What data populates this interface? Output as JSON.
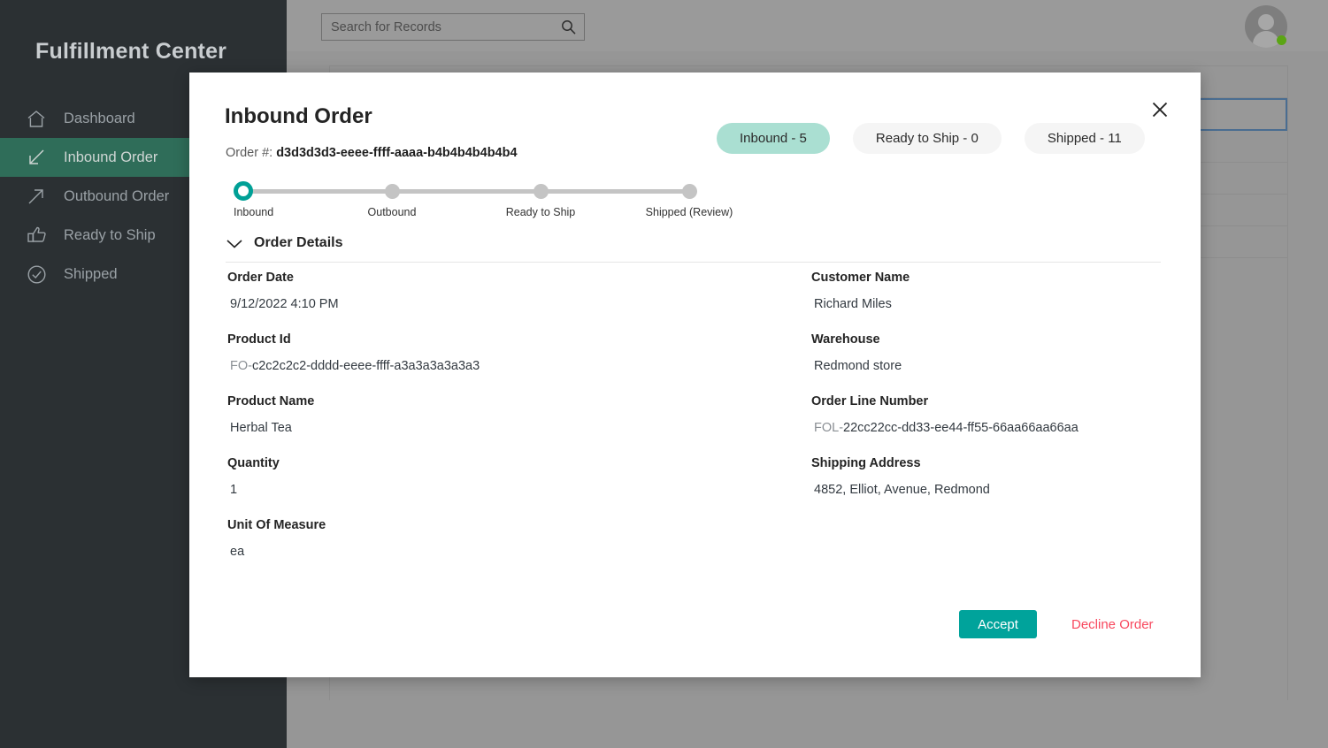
{
  "app": {
    "brand": "Fulfillment Center"
  },
  "sidebar": {
    "items": [
      {
        "label": "Dashboard",
        "icon": "home-icon",
        "active": false
      },
      {
        "label": "Inbound Order",
        "icon": "arrow-down-left-icon",
        "active": true
      },
      {
        "label": "Outbound Order",
        "icon": "arrow-up-right-icon",
        "active": false
      },
      {
        "label": "Ready to Ship",
        "icon": "thumbs-up-icon",
        "active": false
      },
      {
        "label": "Shipped",
        "icon": "check-circle-icon",
        "active": false
      }
    ]
  },
  "topbar": {
    "search": {
      "placeholder": "Search for Records",
      "value": "",
      "icon": "search-icon"
    },
    "avatar": {
      "icon": "avatar-icon",
      "presence": "online",
      "presence_color": "#5ba514"
    }
  },
  "modal": {
    "title": "Inbound Order",
    "close_icon": "close-icon",
    "order_number_label": "Order #:",
    "order_number_value": "d3d3d3d3-eeee-ffff-aaaa-b4b4b4b4b4b4",
    "pills": [
      {
        "label": "Inbound - 5",
        "active": true
      },
      {
        "label": "Ready to Ship - 0",
        "active": false
      },
      {
        "label": "Shipped - 11",
        "active": false
      }
    ],
    "stepper": {
      "steps": [
        {
          "label": "Inbound",
          "current": true
        },
        {
          "label": "Outbound",
          "current": false
        },
        {
          "label": "Ready to Ship",
          "current": false
        },
        {
          "label": "Shipped (Review)",
          "current": false
        }
      ]
    },
    "details": {
      "section_title": "Order Details",
      "chevron_icon": "chevron-down-icon",
      "left_fields": [
        {
          "label": "Order Date",
          "prefix": "",
          "value": "9/12/2022 4:10 PM"
        },
        {
          "label": "Product Id",
          "prefix": "FO-",
          "value": "c2c2c2c2-dddd-eeee-ffff-a3a3a3a3a3a3"
        },
        {
          "label": "Product Name",
          "prefix": "",
          "value": "Herbal Tea"
        },
        {
          "label": "Quantity",
          "prefix": "",
          "value": "1"
        },
        {
          "label": "Unit Of Measure",
          "prefix": "",
          "value": "ea"
        }
      ],
      "right_fields": [
        {
          "label": "Customer Name",
          "prefix": "",
          "value": "Richard Miles"
        },
        {
          "label": "Warehouse",
          "prefix": "",
          "value": "Redmond store"
        },
        {
          "label": "Order Line Number",
          "prefix": "FOL-",
          "value": "22cc22cc-dd33-ee44-ff55-66aa66aa66aa"
        },
        {
          "label": "Shipping Address",
          "prefix": "",
          "value": "4852, Elliot, Avenue, Redmond"
        }
      ]
    },
    "actions": {
      "accept_label": "Accept",
      "decline_label": "Decline Order"
    }
  },
  "colors": {
    "sidebar_bg": "#2b3033",
    "sidebar_active": "#2f6d59",
    "accent_teal": "#00a39b",
    "pill_active": "#aadfd2",
    "decline_red": "#f8485e",
    "overlay": "#969696",
    "row_selected_border": "#4a6d91"
  },
  "background_records": {
    "row_count": 6,
    "selected_row_index": 1
  }
}
